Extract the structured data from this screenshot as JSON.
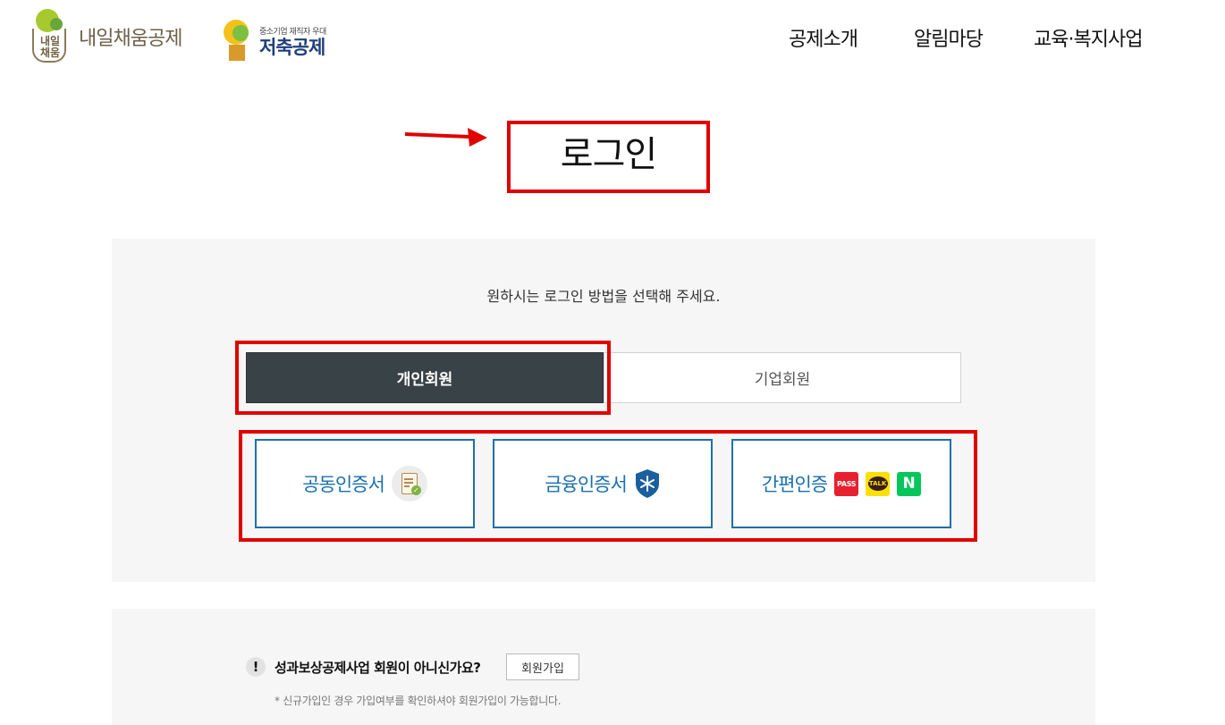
{
  "header": {
    "logo_primary": {
      "mark_text": [
        "내일",
        "채움"
      ],
      "name": "내일채움공제"
    },
    "logo_secondary": {
      "subtitle": "중소기업 재직자 우대",
      "name": "저축공제"
    },
    "nav": [
      {
        "label": "공제소개"
      },
      {
        "label": "알림마당"
      },
      {
        "label": "교육·복지사업"
      }
    ]
  },
  "main": {
    "title": "로그인",
    "instruction": "원하시는 로그인 방법을 선택해 주세요.",
    "tabs": [
      {
        "label": "개인회원",
        "active": true
      },
      {
        "label": "기업회원",
        "active": false
      }
    ],
    "methods": [
      {
        "label": "공동인증서",
        "icon": "certificate-icon"
      },
      {
        "label": "금융인증서",
        "icon": "shield-icon"
      },
      {
        "label": "간편인증",
        "icon": "easy-auth-icons",
        "badges": [
          "PASS",
          "TALK",
          "N"
        ]
      }
    ]
  },
  "signup": {
    "notice": "성과보상공제사업 회원이 아니신가요?",
    "button_label": "회원가입",
    "note": "* 신규가입인 경우 가입여부를 확인하셔야 회원가입이 가능합니다."
  },
  "colors": {
    "annotation_red": "#e00000",
    "active_tab": "#394246",
    "method_border": "#1f6fa8",
    "method_text": "#1c6fae",
    "panel_bg": "#f6f6f6"
  }
}
